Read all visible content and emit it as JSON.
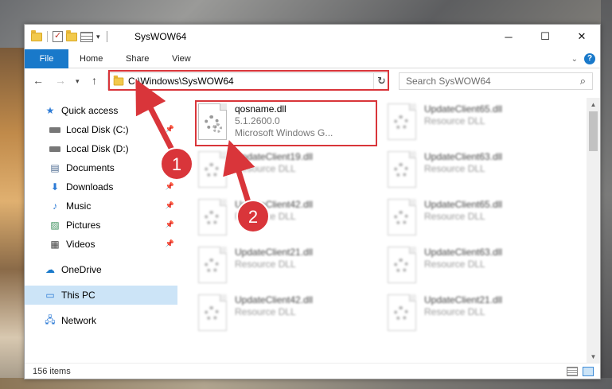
{
  "window": {
    "title": "SysWOW64",
    "controls": {
      "minimize": "─",
      "maximize": "☐",
      "close": "✕"
    }
  },
  "ribbon": {
    "tabs": [
      "File",
      "Home",
      "Share",
      "View"
    ],
    "collapse_icon": "chevron-down-icon",
    "help_label": "?"
  },
  "address": {
    "path": "C:\\Windows\\SysWOW64",
    "search_placeholder": "Search SysWOW64"
  },
  "sidebar": {
    "items": [
      {
        "label": "Quick access",
        "icon": "star-icon",
        "pinned": false
      },
      {
        "label": "Local Disk (C:)",
        "icon": "drive-icon",
        "pinned": true
      },
      {
        "label": "Local Disk (D:)",
        "icon": "drive-icon",
        "pinned": false
      },
      {
        "label": "Documents",
        "icon": "documents-icon",
        "pinned": true
      },
      {
        "label": "Downloads",
        "icon": "downloads-icon",
        "pinned": true
      },
      {
        "label": "Music",
        "icon": "music-icon",
        "pinned": true
      },
      {
        "label": "Pictures",
        "icon": "pictures-icon",
        "pinned": true
      },
      {
        "label": "Videos",
        "icon": "videos-icon",
        "pinned": true
      },
      {
        "label": "OneDrive",
        "icon": "cloud-icon",
        "pinned": false
      },
      {
        "label": "This PC",
        "icon": "computer-icon",
        "pinned": false,
        "selected": true
      },
      {
        "label": "Network",
        "icon": "network-icon",
        "pinned": false
      }
    ]
  },
  "files": [
    {
      "name": "qosname.dll",
      "line2": "5.1.2600.0",
      "line3": "Microsoft Windows G...",
      "highlighted": true
    },
    {
      "name": "UpdateClient65.dll",
      "line2": "Resource DLL"
    },
    {
      "name": "UpdateClient19.dll",
      "line2": "Resource DLL"
    },
    {
      "name": "UpdateClient63.dll",
      "line2": "Resource DLL"
    },
    {
      "name": "UpdateClient42.dll",
      "line2": "Resource DLL"
    },
    {
      "name": "UpdateClient65.dll",
      "line2": "Resource DLL"
    },
    {
      "name": "UpdateClient21.dll",
      "line2": "Resource DLL"
    },
    {
      "name": "UpdateClient63.dll",
      "line2": "Resource DLL"
    },
    {
      "name": "UpdateClient42.dll",
      "line2": "Resource DLL"
    },
    {
      "name": "UpdateClient21.dll",
      "line2": "Resource DLL"
    }
  ],
  "status": {
    "item_count": "156 items"
  },
  "annotations": {
    "step1": "1",
    "step2": "2",
    "color": "#d9353a"
  }
}
